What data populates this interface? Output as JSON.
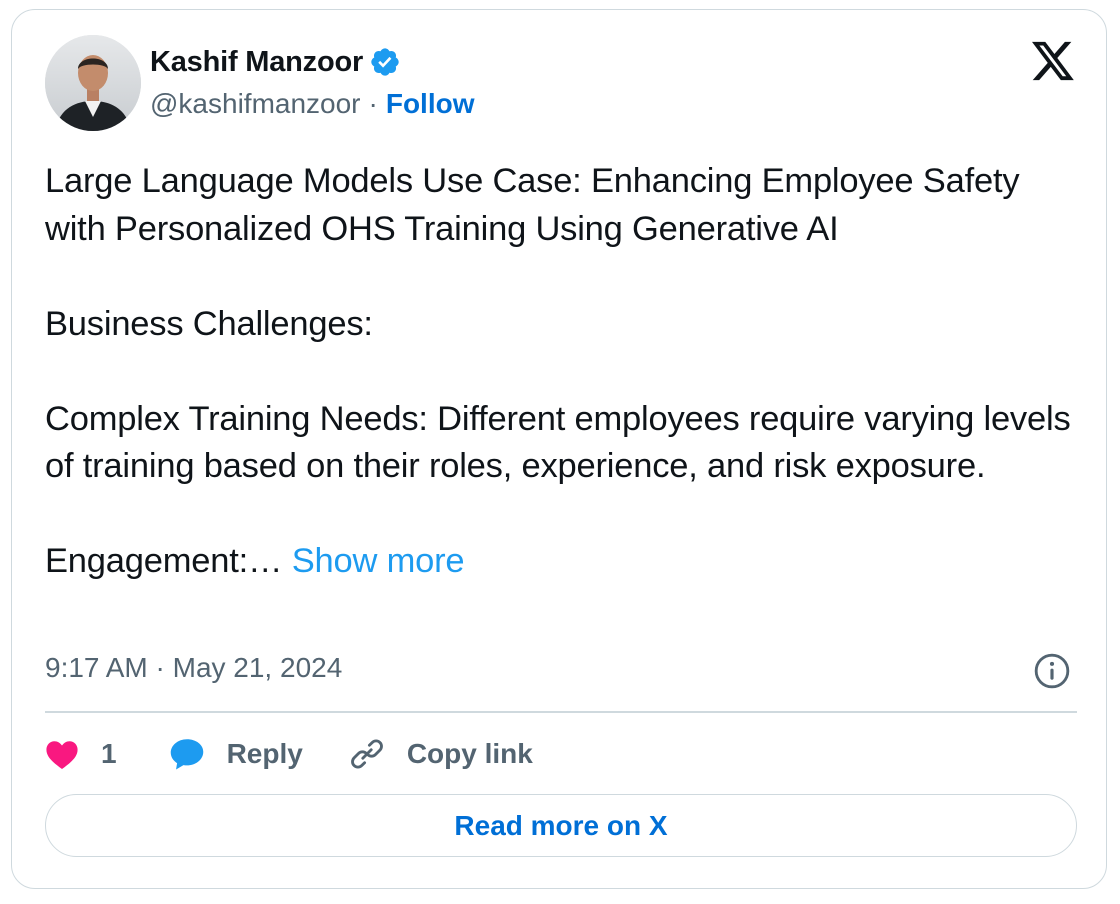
{
  "author": {
    "name": "Kashif Manzoor",
    "handle": "@kashifmanzoor",
    "separator": "·",
    "follow_label": "Follow"
  },
  "tweet": {
    "paragraphs": [
      "Large Language Models Use Case: Enhancing Employee Safety with Personalized OHS Training Using Generative AI",
      "Business Challenges:",
      "Complex Training Needs: Different employees require varying levels of training based on their roles, experience, and risk exposure."
    ],
    "truncated_text": "Engagement:…",
    "show_more_label": "Show more",
    "timestamp": "9:17 AM · May 21, 2024"
  },
  "actions": {
    "like_count": "1",
    "reply_label": "Reply",
    "copy_label": "Copy link"
  },
  "read_more_label": "Read more on X",
  "icons": {
    "verified": "verified-badge-icon",
    "platform": "x-logo-icon",
    "info": "info-icon",
    "like": "heart-icon",
    "reply": "speech-bubble-icon",
    "copy": "link-icon"
  },
  "colors": {
    "link": "#006fd6",
    "show_more": "#1d9bf0",
    "verified": "#1d9bf0",
    "heart": "#f91880",
    "secondary_text": "#536471",
    "border": "#cfd9de"
  }
}
